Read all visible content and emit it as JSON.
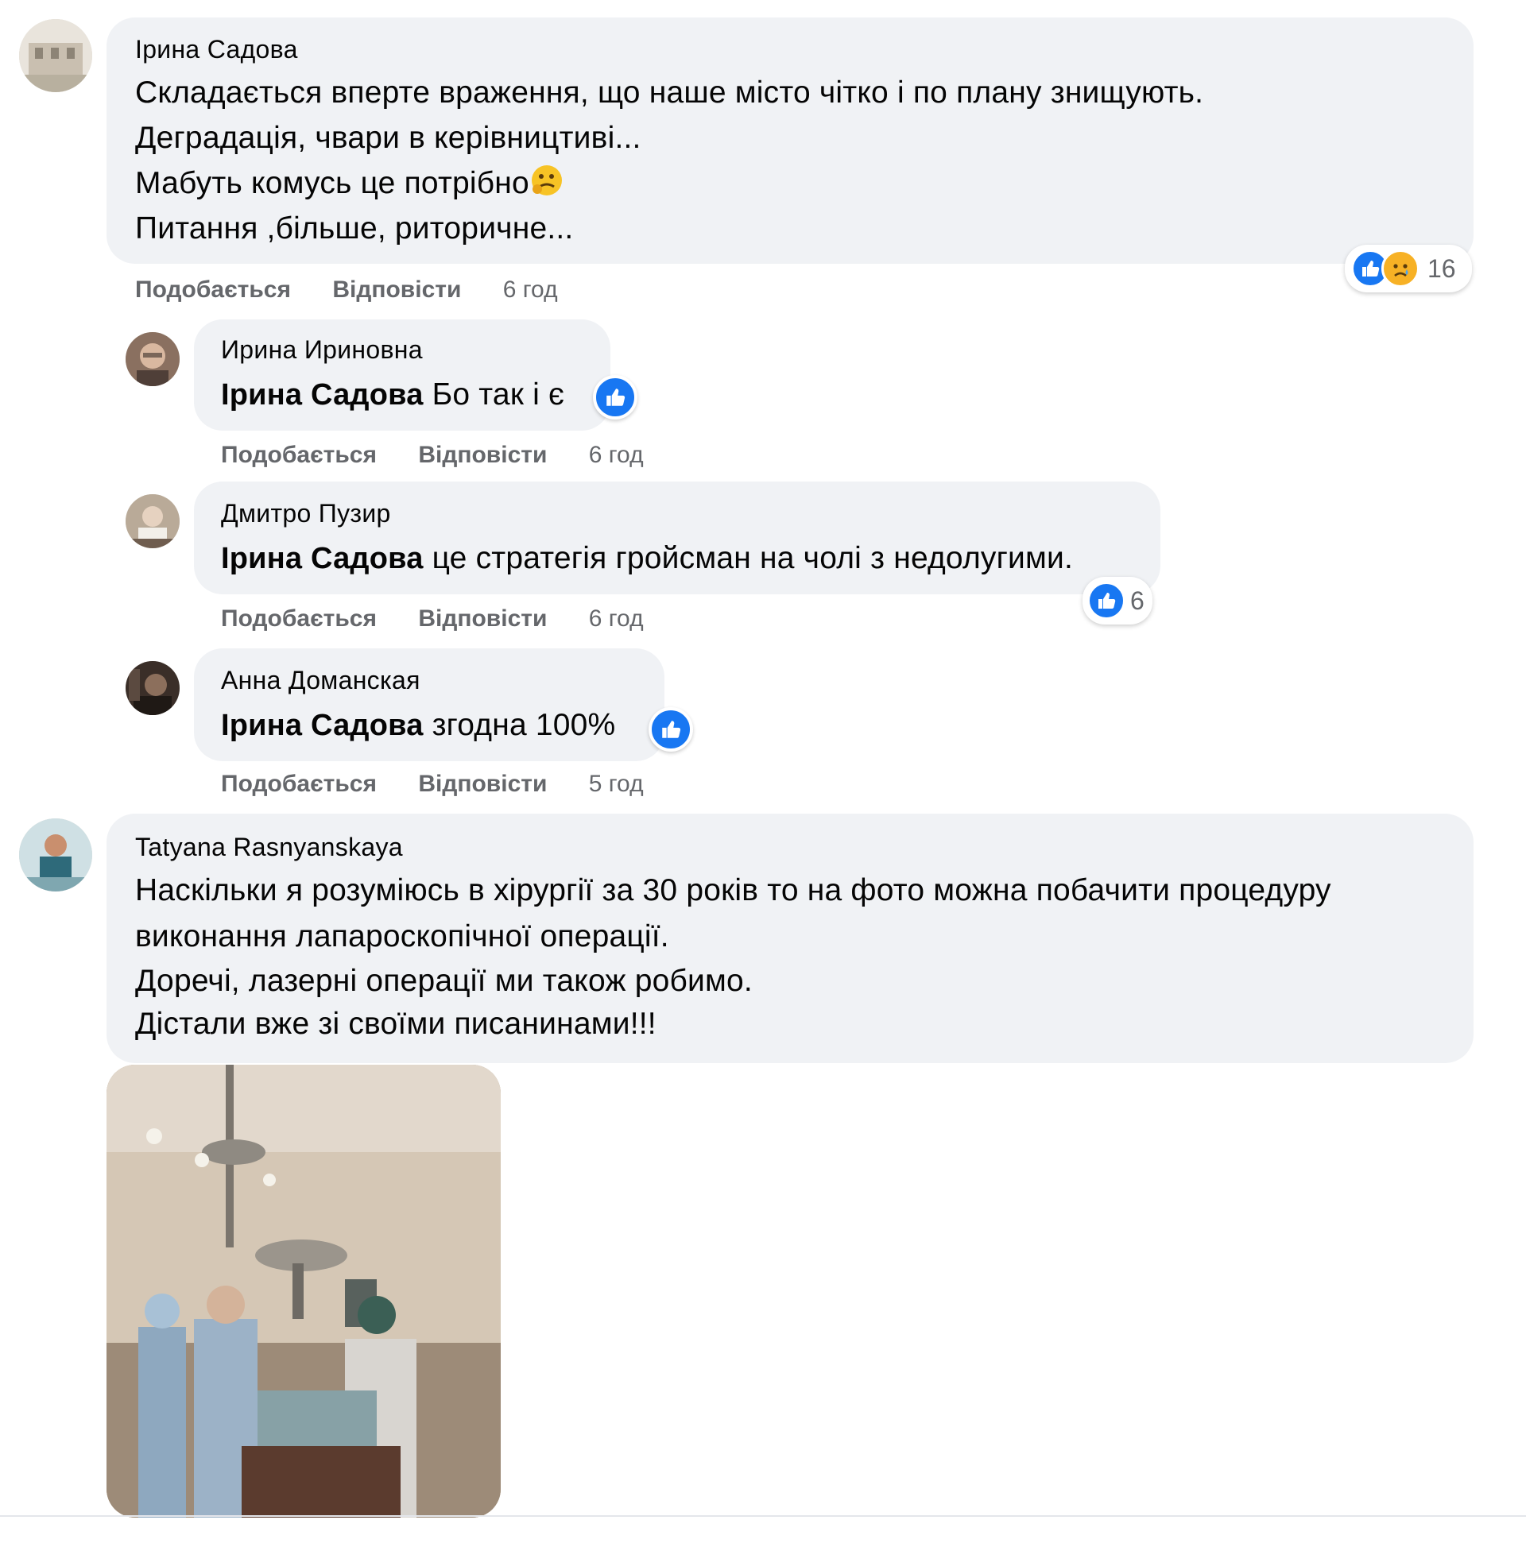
{
  "comments": [
    {
      "author": "Ірина Садова",
      "lines": [
        "Складається вперте враження, що наше місто чітко і по плану знищують.",
        "Деградація, чвари в керівництиві...",
        "Мабуть комусь це потрібно",
        "Питання ,більше, риторичне..."
      ],
      "actions": {
        "like": "Подобається",
        "reply": "Відповісти",
        "time": "6 год"
      },
      "reactions": {
        "types": [
          "like-icon",
          "sad-icon"
        ],
        "count": "16"
      }
    },
    {
      "author": "Ирина Ириновна",
      "mention": "Ірина Садова",
      "text": " Бо так і є",
      "actions": {
        "like": "Подобається",
        "reply": "Відповісти",
        "time": "6 год"
      },
      "reactions": {
        "types": [
          "like-icon"
        ],
        "count": ""
      }
    },
    {
      "author": "Дмитро Пузир",
      "mention": "Ірина Садова",
      "text": " це стратегія гройсман на чолі з недолугими.",
      "actions": {
        "like": "Подобається",
        "reply": "Відповісти",
        "time": "6 год"
      },
      "reactions": {
        "types": [
          "like-icon"
        ],
        "count": "6"
      }
    },
    {
      "author": "Анна Доманская",
      "mention": "Ірина Садова",
      "text": " згодна 100%",
      "actions": {
        "like": "Подобається",
        "reply": "Відповісти",
        "time": "5 год"
      },
      "reactions": {
        "types": [
          "like-icon"
        ],
        "count": ""
      }
    },
    {
      "author": "Tatyana Rasnyanskaya",
      "lines": [
        "Наскільки я розуміюсь в хірургії за 30 років то на фото можна побачити процедуру",
        "виконання лапароскопічної операції.",
        "Доречі, лазерні операції ми також робимо.",
        "Дістали вже зі своїми писанинами!!!"
      ],
      "attachment": "operating-room-photo"
    }
  ],
  "colors": {
    "bubble": "#f0f2f5",
    "secondary_text": "#65676b",
    "like_blue": "#1877f2",
    "sad_yellow": "#f7b125"
  }
}
